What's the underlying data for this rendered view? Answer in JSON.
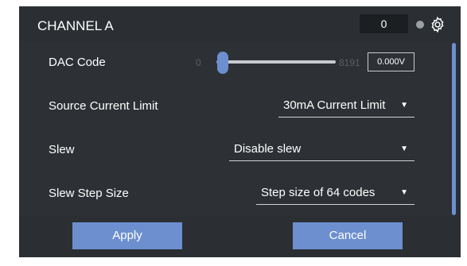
{
  "header": {
    "title": "CHANNEL A",
    "code_value": "0"
  },
  "rows": {
    "dac_code": {
      "label": "DAC Code",
      "min": "0",
      "max": "8191",
      "voltage": "0.000V"
    },
    "source_current_limit": {
      "label": "Source Current Limit",
      "value": "30mA Current Limit"
    },
    "slew": {
      "label": "Slew",
      "value": "Disable slew"
    },
    "slew_step_size": {
      "label": "Slew Step Size",
      "value": "Step size of 64 codes"
    }
  },
  "footer": {
    "apply_label": "Apply",
    "cancel_label": "Cancel"
  },
  "icons": {
    "arrow": "▼",
    "settings": "gear-icon"
  },
  "colors": {
    "accent": "#6d8fcf",
    "panel": "#2d3135",
    "header": "#2b2f33"
  }
}
